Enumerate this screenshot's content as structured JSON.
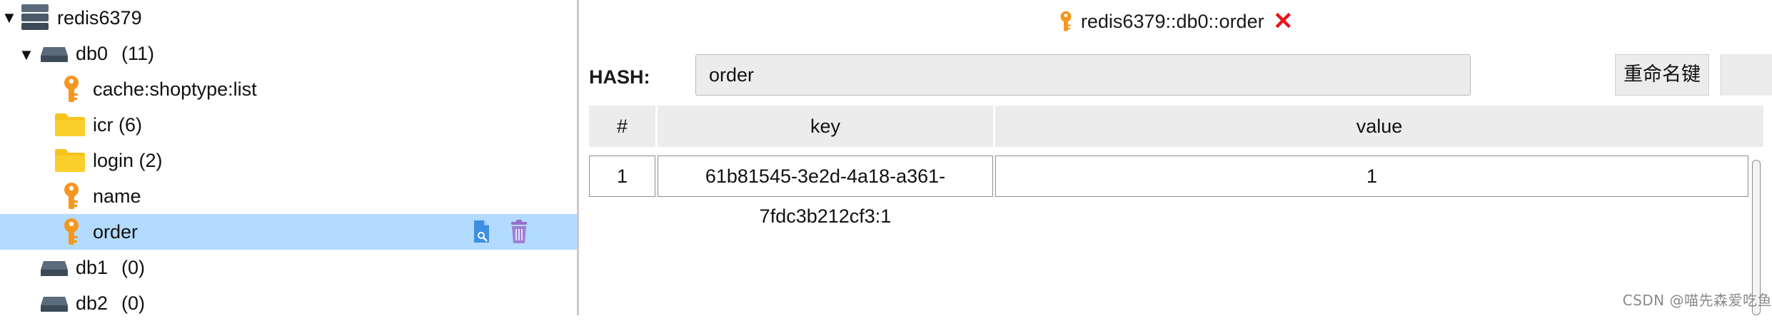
{
  "tree": {
    "server": {
      "label": "redis6379",
      "expanded_arrow": "▼",
      "icon": "server-icon"
    },
    "db0": {
      "name": "db0",
      "count": "(11)",
      "expanded_arrow": "▼",
      "icon": "database-icon"
    },
    "items": [
      {
        "label": "cache:shoptype:list",
        "icon": "key-icon"
      },
      {
        "label": "icr (6)",
        "icon": "folder-icon"
      },
      {
        "label": "login (2)",
        "icon": "folder-icon"
      },
      {
        "label": "name",
        "icon": "key-icon"
      },
      {
        "label": "order",
        "icon": "key-icon",
        "selected": true
      }
    ],
    "other_dbs": [
      {
        "name": "db1",
        "count": "(0)",
        "icon": "database-icon"
      },
      {
        "name": "db2",
        "count": "(0)",
        "icon": "database-icon"
      }
    ],
    "selected_bg": "#b3dbff"
  },
  "detail": {
    "title": "redis6379::db0::order",
    "close_glyph": "✕",
    "type_label": "HASH:",
    "key_name": "order",
    "rename_button": "重命名键",
    "table": {
      "headers": [
        "#",
        "key",
        "value"
      ],
      "rows": [
        {
          "index": "1",
          "key": "61b81545-3e2d-4a18-a361-7fdc3b212cf3:1",
          "value": "1"
        }
      ]
    }
  },
  "watermark": "CSDN @喵先森爱吃鱼",
  "colors": {
    "key_orange": "#f5961e",
    "folder_yellow": "#f6c41c",
    "close_red": "#e8141c",
    "db_slate": "#4a5a6a"
  }
}
